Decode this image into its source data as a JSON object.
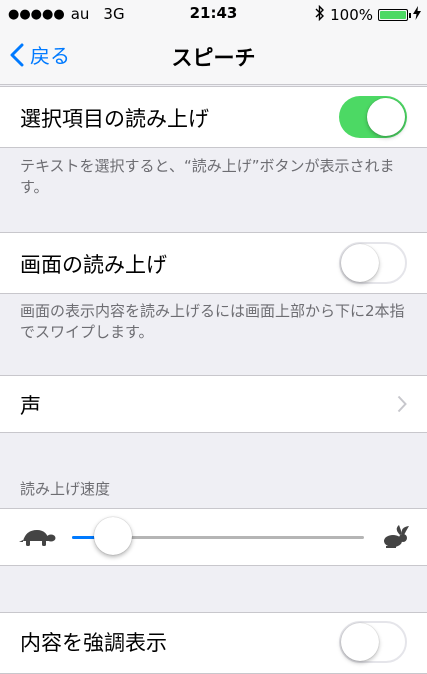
{
  "status_bar": {
    "signal": "●●●●●",
    "carrier": "au",
    "network": "3G",
    "time": "21:43",
    "battery": "100%",
    "battery_level": 1.0
  },
  "nav": {
    "back_label": "戻る",
    "title": "スピーチ"
  },
  "speak_selection": {
    "label": "選択項目の読み上げ",
    "on": true,
    "footer": "テキストを選択すると、“読み上げ”ボタンが表示されます。"
  },
  "speak_screen": {
    "label": "画面の読み上げ",
    "on": false,
    "footer": "画面の表示内容を読み上げるには画面上部から下に2本指でスワイプします。"
  },
  "voice": {
    "label": "声"
  },
  "speaking_rate": {
    "header": "読み上げ速度",
    "value": 0.14,
    "slow_icon": "turtle-icon",
    "fast_icon": "rabbit-icon"
  },
  "highlight": {
    "label": "内容を強調表示",
    "on": false
  },
  "colors": {
    "accent": "#007aff",
    "toggle_on": "#4cd964"
  }
}
